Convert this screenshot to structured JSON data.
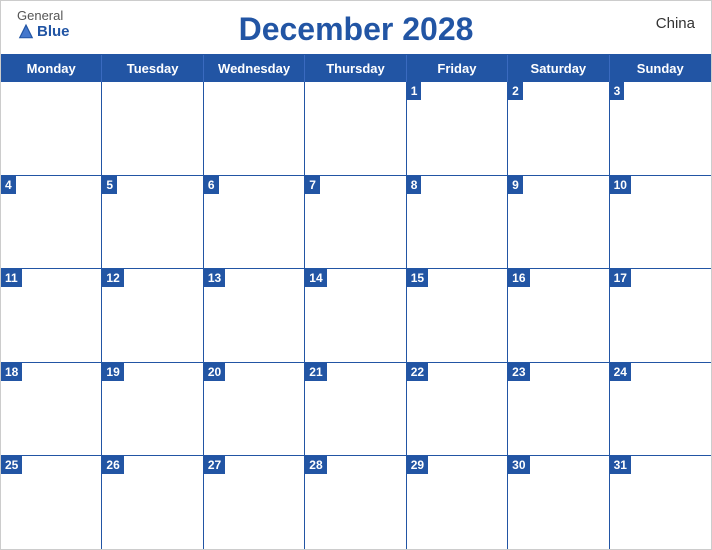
{
  "header": {
    "logo_general": "General",
    "logo_blue": "Blue",
    "title": "December 2028",
    "country": "China"
  },
  "days_of_week": [
    "Monday",
    "Tuesday",
    "Wednesday",
    "Thursday",
    "Friday",
    "Saturday",
    "Sunday"
  ],
  "weeks": [
    [
      {
        "date": "",
        "empty": true
      },
      {
        "date": "",
        "empty": true
      },
      {
        "date": "",
        "empty": true
      },
      {
        "date": "",
        "empty": true
      },
      {
        "date": "1"
      },
      {
        "date": "2"
      },
      {
        "date": "3"
      }
    ],
    [
      {
        "date": "4"
      },
      {
        "date": "5"
      },
      {
        "date": "6"
      },
      {
        "date": "7"
      },
      {
        "date": "8"
      },
      {
        "date": "9"
      },
      {
        "date": "10"
      }
    ],
    [
      {
        "date": "11"
      },
      {
        "date": "12"
      },
      {
        "date": "13"
      },
      {
        "date": "14"
      },
      {
        "date": "15"
      },
      {
        "date": "16"
      },
      {
        "date": "17"
      }
    ],
    [
      {
        "date": "18"
      },
      {
        "date": "19"
      },
      {
        "date": "20"
      },
      {
        "date": "21"
      },
      {
        "date": "22"
      },
      {
        "date": "23"
      },
      {
        "date": "24"
      }
    ],
    [
      {
        "date": "25"
      },
      {
        "date": "26"
      },
      {
        "date": "27"
      },
      {
        "date": "28"
      },
      {
        "date": "29"
      },
      {
        "date": "30"
      },
      {
        "date": "31"
      }
    ]
  ]
}
